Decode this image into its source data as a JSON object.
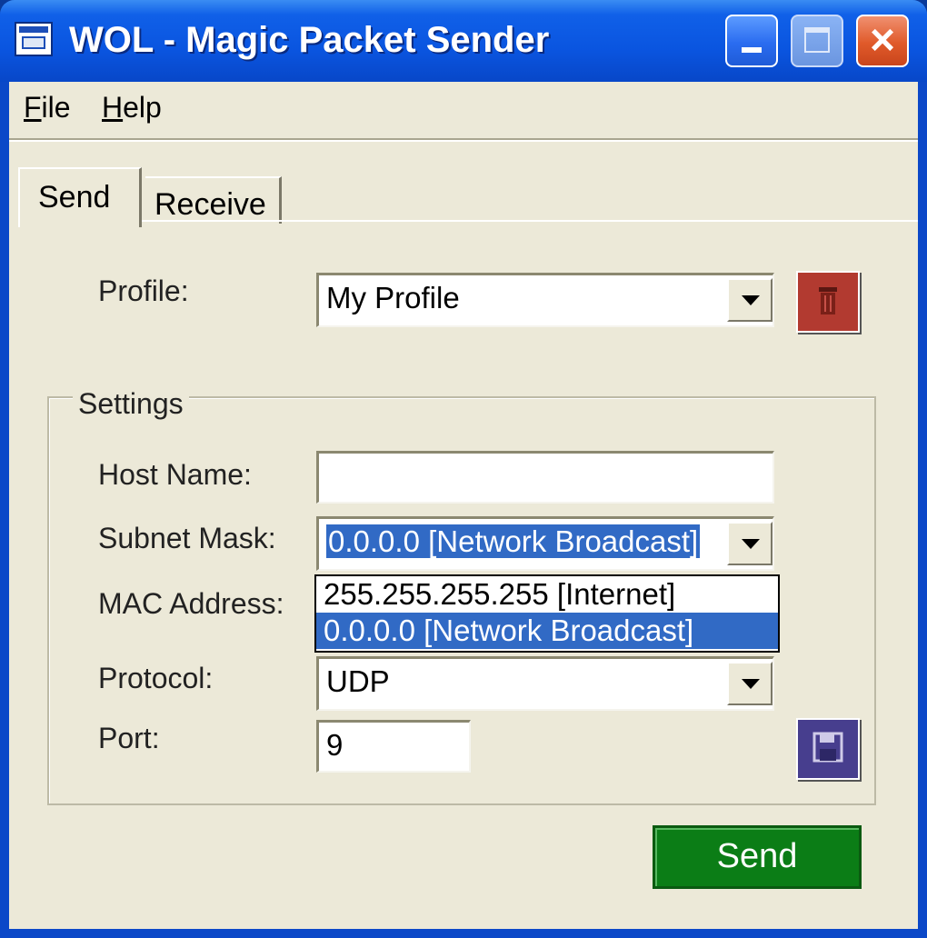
{
  "window": {
    "title": "WOL - Magic Packet Sender"
  },
  "menu": {
    "file": {
      "accel": "F",
      "rest": "ile"
    },
    "help": {
      "accel": "H",
      "rest": "elp"
    }
  },
  "tabs": {
    "send": "Send",
    "receive": "Receive"
  },
  "profile": {
    "label": "Profile:",
    "value": "My Profile"
  },
  "settings": {
    "title": "Settings",
    "host_label": "Host Name:",
    "host_value": "",
    "subnet_label": "Subnet Mask:",
    "subnet_value": "0.0.0.0 [Network Broadcast]",
    "subnet_options": [
      "255.255.255.255 [Internet]",
      "0.0.0.0 [Network Broadcast]"
    ],
    "mac_label": "MAC Address:",
    "protocol_label": "Protocol:",
    "protocol_value": "UDP",
    "port_label": "Port:",
    "port_value": "9"
  },
  "actions": {
    "send": "Send"
  },
  "icons": {
    "delete": "trash-icon",
    "save": "floppy-disk-icon",
    "close": "×"
  },
  "colors": {
    "delete_button": "#b23a30",
    "save_button": "#473e8e",
    "send_button": "#0b7d16",
    "selection": "#316ac5"
  }
}
